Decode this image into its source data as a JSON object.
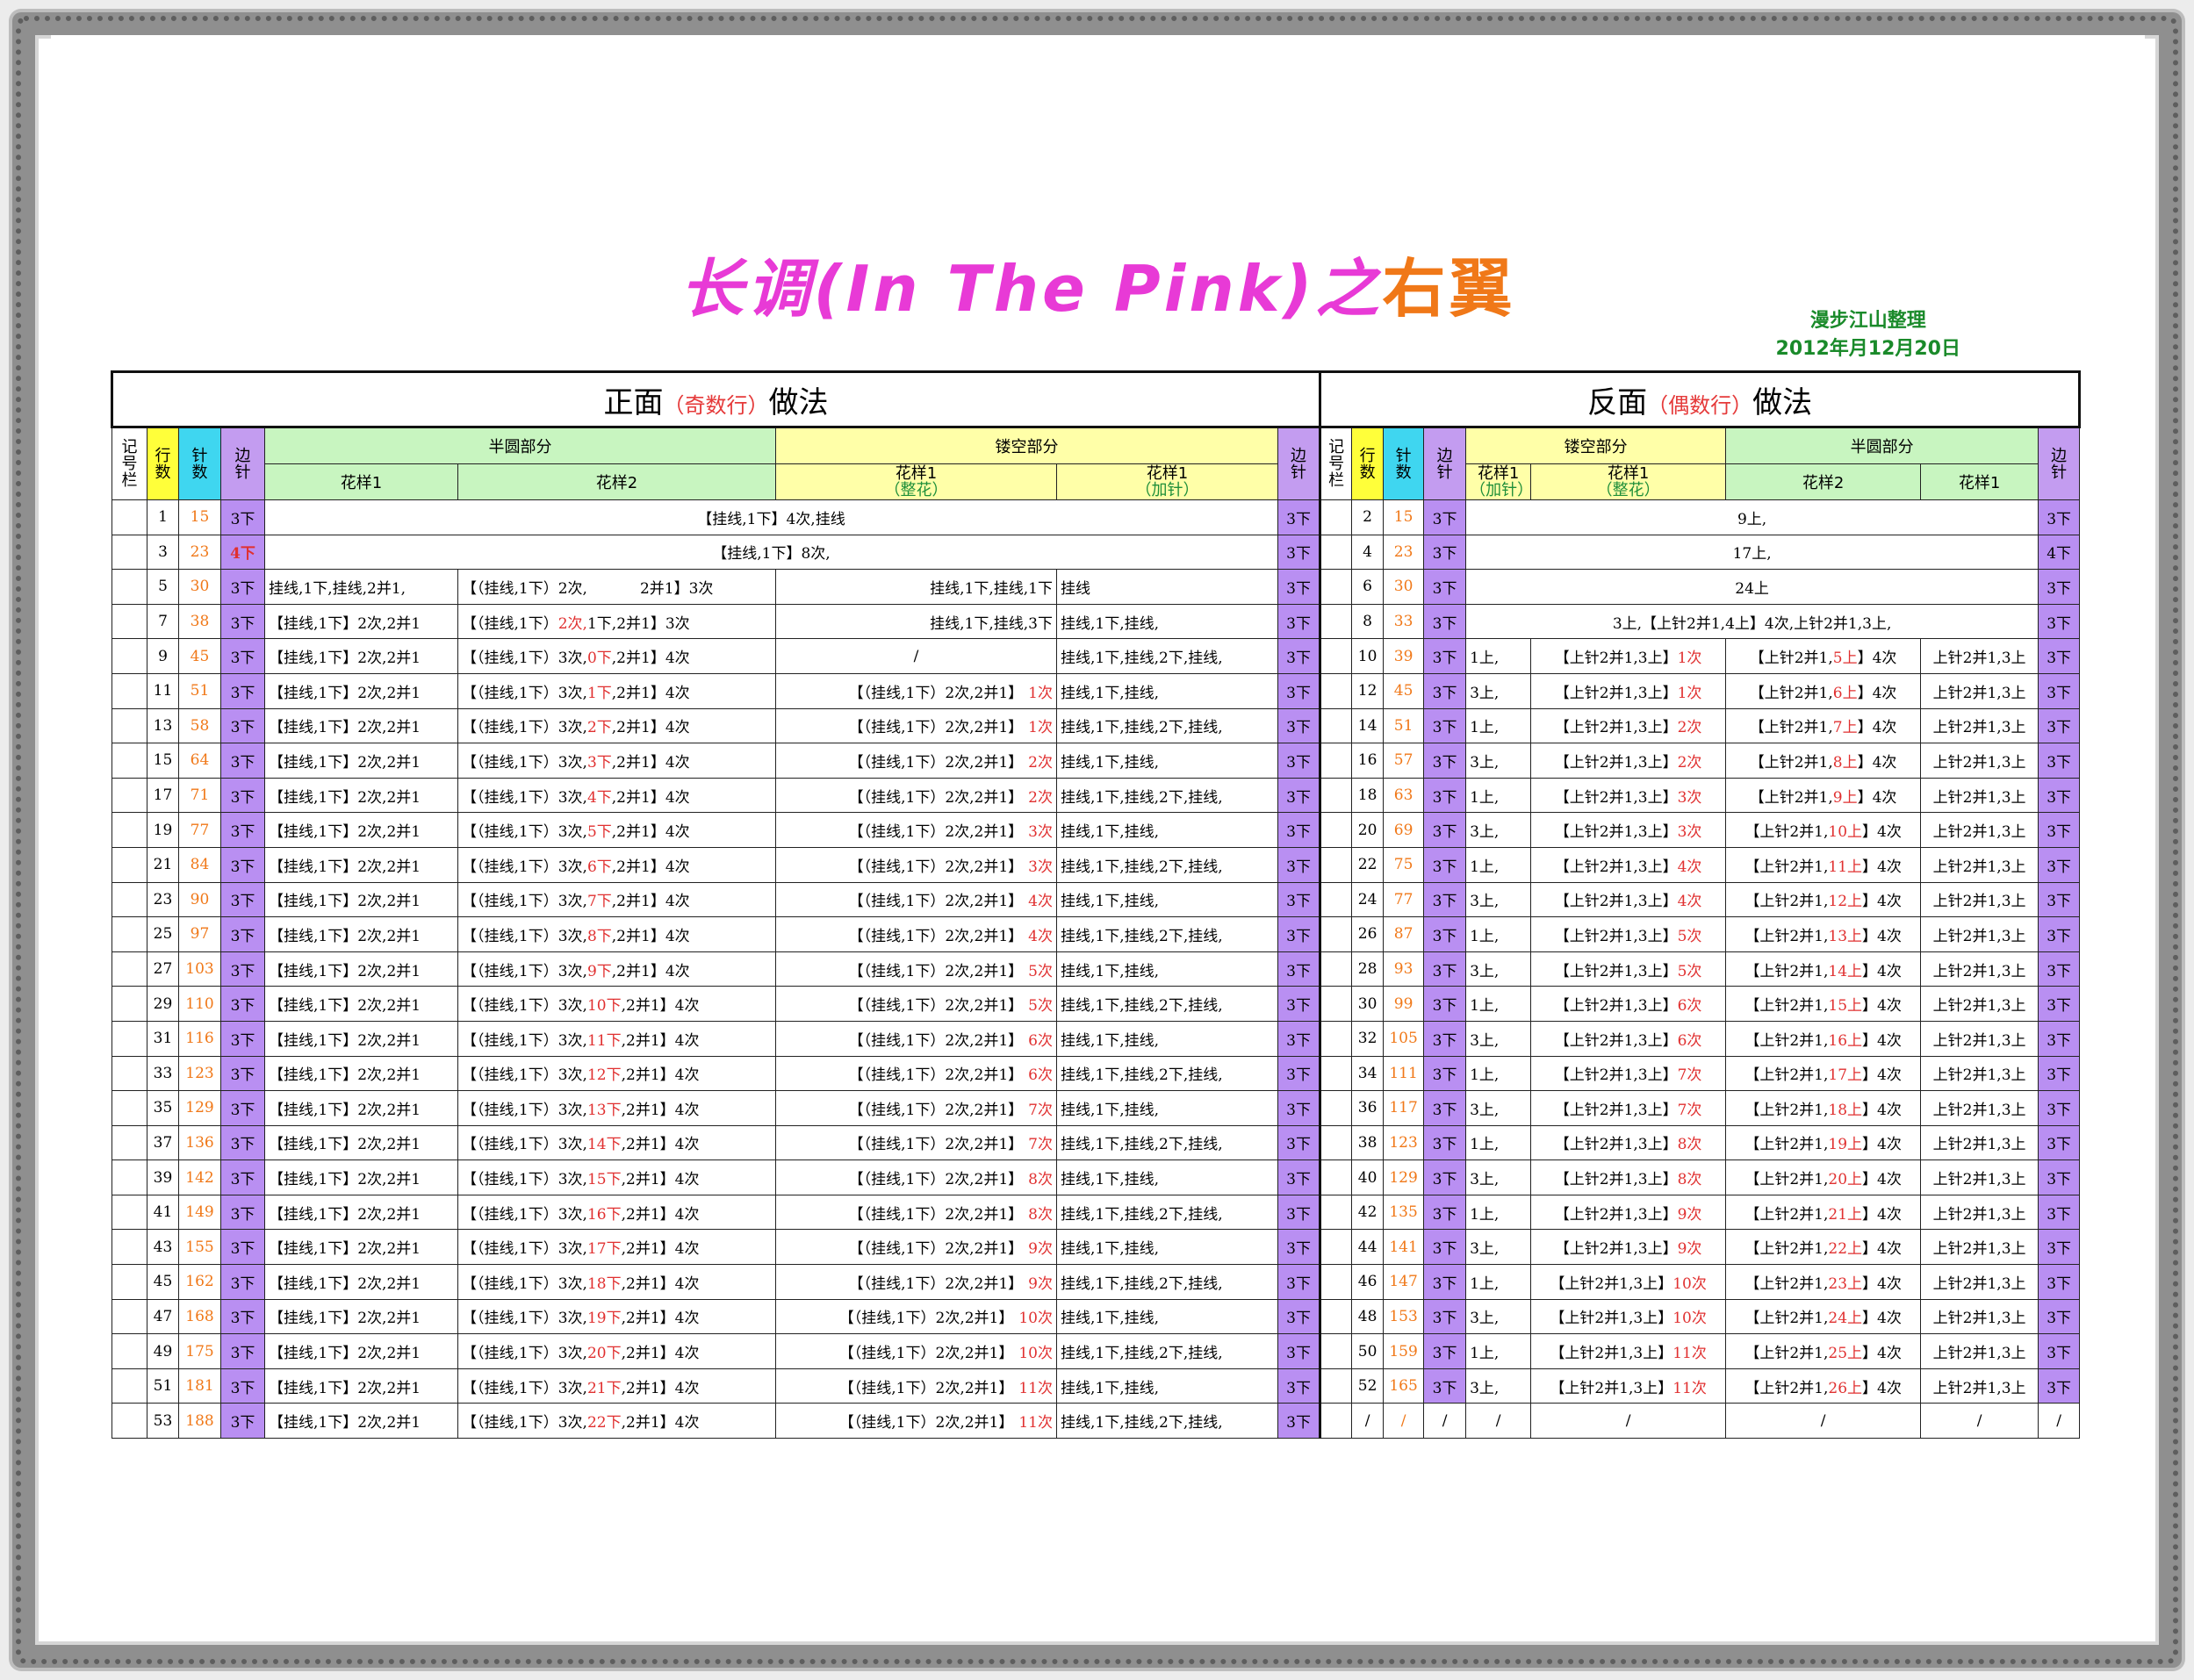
{
  "title": {
    "main": "长调(In The Pink)之",
    "accent": "右翼"
  },
  "credit": {
    "line1": "漫步江山整理",
    "line2": "2012年月12月20日"
  },
  "front": {
    "caption": "正面",
    "caption_sub": "（奇数行）",
    "caption_tail": "做法"
  },
  "back": {
    "caption": "反面",
    "caption_sub": "（偶数行）",
    "caption_tail": "做法"
  },
  "headers": {
    "jihao": "记号栏",
    "hang": "行数",
    "zhen": "针数",
    "bian": "边针",
    "banyuan": "半圆部分",
    "lougkong": "镂空部分",
    "huayang1": "花样1",
    "huayang2": "花样2",
    "zhenghua": "（整花）",
    "jiazhen": "（加针）"
  },
  "front_rows": [
    {
      "r": "1",
      "n": "15",
      "e": "3下",
      "merged": "【挂线,1下】4次,挂线"
    },
    {
      "r": "3",
      "n": "23",
      "e": "4下",
      "merged": "【挂线,1下】8次,"
    },
    {
      "r": "5",
      "n": "30",
      "e": "3下",
      "a": "挂线,1下,挂线,2并1,",
      "b1": "【（挂线,1下）2次,",
      "b2": "",
      "b3": "2并1】3次",
      "c1": "挂线,1下,挂线,1下",
      "c2": "",
      "d": "挂线"
    },
    {
      "r": "7",
      "n": "38",
      "e": "3下",
      "a": "【挂线,1下】2次,2并1",
      "b1": "【（挂线,1下）",
      "b2": "2次,",
      "b3": "1下,2并1】3次",
      "c1": "挂线,1下,挂线,3下",
      "c2": "",
      "d": "挂线,1下,挂线,"
    },
    {
      "r": "9",
      "n": "45",
      "e": "3下",
      "a": "【挂线,1下】2次,2并1",
      "b1": "【（挂线,1下）3次,",
      "b2": "0下",
      "b3": ",2并1】4次",
      "c1": "/",
      "c2": "",
      "d": "挂线,1下,挂线,2下,挂线,"
    },
    {
      "r": "11",
      "n": "51",
      "e": "3下",
      "a": "【挂线,1下】2次,2并1",
      "b1": "【（挂线,1下）3次,",
      "b2": "1下",
      "b3": ",2并1】4次",
      "c1": "【（挂线,1下）2次,2并1】",
      "c2": "1次",
      "d": "挂线,1下,挂线,"
    },
    {
      "r": "13",
      "n": "58",
      "e": "3下",
      "a": "【挂线,1下】2次,2并1",
      "b1": "【（挂线,1下）3次,",
      "b2": "2下",
      "b3": ",2并1】4次",
      "c1": "【（挂线,1下）2次,2并1】",
      "c2": "1次",
      "d": "挂线,1下,挂线,2下,挂线,"
    },
    {
      "r": "15",
      "n": "64",
      "e": "3下",
      "a": "【挂线,1下】2次,2并1",
      "b1": "【（挂线,1下）3次,",
      "b2": "3下",
      "b3": ",2并1】4次",
      "c1": "【（挂线,1下）2次,2并1】",
      "c2": "2次",
      "d": "挂线,1下,挂线,"
    },
    {
      "r": "17",
      "n": "71",
      "e": "3下",
      "a": "【挂线,1下】2次,2并1",
      "b1": "【（挂线,1下）3次,",
      "b2": "4下",
      "b3": ",2并1】4次",
      "c1": "【（挂线,1下）2次,2并1】",
      "c2": "2次",
      "d": "挂线,1下,挂线,2下,挂线,"
    },
    {
      "r": "19",
      "n": "77",
      "e": "3下",
      "a": "【挂线,1下】2次,2并1",
      "b1": "【（挂线,1下）3次,",
      "b2": "5下",
      "b3": ",2并1】4次",
      "c1": "【（挂线,1下）2次,2并1】",
      "c2": "3次",
      "d": "挂线,1下,挂线,"
    },
    {
      "r": "21",
      "n": "84",
      "e": "3下",
      "a": "【挂线,1下】2次,2并1",
      "b1": "【（挂线,1下）3次,",
      "b2": "6下",
      "b3": ",2并1】4次",
      "c1": "【（挂线,1下）2次,2并1】",
      "c2": "3次",
      "d": "挂线,1下,挂线,2下,挂线,"
    },
    {
      "r": "23",
      "n": "90",
      "e": "3下",
      "a": "【挂线,1下】2次,2并1",
      "b1": "【（挂线,1下）3次,",
      "b2": "7下",
      "b3": ",2并1】4次",
      "c1": "【（挂线,1下）2次,2并1】",
      "c2": "4次",
      "d": "挂线,1下,挂线,"
    },
    {
      "r": "25",
      "n": "97",
      "e": "3下",
      "a": "【挂线,1下】2次,2并1",
      "b1": "【（挂线,1下）3次,",
      "b2": "8下",
      "b3": ",2并1】4次",
      "c1": "【（挂线,1下）2次,2并1】",
      "c2": "4次",
      "d": "挂线,1下,挂线,2下,挂线,"
    },
    {
      "r": "27",
      "n": "103",
      "e": "3下",
      "a": "【挂线,1下】2次,2并1",
      "b1": "【（挂线,1下）3次,",
      "b2": "9下",
      "b3": ",2并1】4次",
      "c1": "【（挂线,1下）2次,2并1】",
      "c2": "5次",
      "d": "挂线,1下,挂线,"
    },
    {
      "r": "29",
      "n": "110",
      "e": "3下",
      "a": "【挂线,1下】2次,2并1",
      "b1": "【（挂线,1下）3次,",
      "b2": "10下",
      "b3": ",2并1】4次",
      "c1": "【（挂线,1下）2次,2并1】",
      "c2": "5次",
      "d": "挂线,1下,挂线,2下,挂线,"
    },
    {
      "r": "31",
      "n": "116",
      "e": "3下",
      "a": "【挂线,1下】2次,2并1",
      "b1": "【（挂线,1下）3次,",
      "b2": "11下",
      "b3": ",2并1】4次",
      "c1": "【（挂线,1下）2次,2并1】",
      "c2": "6次",
      "d": "挂线,1下,挂线,"
    },
    {
      "r": "33",
      "n": "123",
      "e": "3下",
      "a": "【挂线,1下】2次,2并1",
      "b1": "【（挂线,1下）3次,",
      "b2": "12下",
      "b3": ",2并1】4次",
      "c1": "【（挂线,1下）2次,2并1】",
      "c2": "6次",
      "d": "挂线,1下,挂线,2下,挂线,"
    },
    {
      "r": "35",
      "n": "129",
      "e": "3下",
      "a": "【挂线,1下】2次,2并1",
      "b1": "【（挂线,1下）3次,",
      "b2": "13下",
      "b3": ",2并1】4次",
      "c1": "【（挂线,1下）2次,2并1】",
      "c2": "7次",
      "d": "挂线,1下,挂线,"
    },
    {
      "r": "37",
      "n": "136",
      "e": "3下",
      "a": "【挂线,1下】2次,2并1",
      "b1": "【（挂线,1下）3次,",
      "b2": "14下",
      "b3": ",2并1】4次",
      "c1": "【（挂线,1下）2次,2并1】",
      "c2": "7次",
      "d": "挂线,1下,挂线,2下,挂线,"
    },
    {
      "r": "39",
      "n": "142",
      "e": "3下",
      "a": "【挂线,1下】2次,2并1",
      "b1": "【（挂线,1下）3次,",
      "b2": "15下",
      "b3": ",2并1】4次",
      "c1": "【（挂线,1下）2次,2并1】",
      "c2": "8次",
      "d": "挂线,1下,挂线,"
    },
    {
      "r": "41",
      "n": "149",
      "e": "3下",
      "a": "【挂线,1下】2次,2并1",
      "b1": "【（挂线,1下）3次,",
      "b2": "16下",
      "b3": ",2并1】4次",
      "c1": "【（挂线,1下）2次,2并1】",
      "c2": "8次",
      "d": "挂线,1下,挂线,2下,挂线,"
    },
    {
      "r": "43",
      "n": "155",
      "e": "3下",
      "a": "【挂线,1下】2次,2并1",
      "b1": "【（挂线,1下）3次,",
      "b2": "17下",
      "b3": ",2并1】4次",
      "c1": "【（挂线,1下）2次,2并1】",
      "c2": "9次",
      "d": "挂线,1下,挂线,"
    },
    {
      "r": "45",
      "n": "162",
      "e": "3下",
      "a": "【挂线,1下】2次,2并1",
      "b1": "【（挂线,1下）3次,",
      "b2": "18下",
      "b3": ",2并1】4次",
      "c1": "【（挂线,1下）2次,2并1】",
      "c2": "9次",
      "d": "挂线,1下,挂线,2下,挂线,"
    },
    {
      "r": "47",
      "n": "168",
      "e": "3下",
      "a": "【挂线,1下】2次,2并1",
      "b1": "【（挂线,1下）3次,",
      "b2": "19下",
      "b3": ",2并1】4次",
      "c1": "【（挂线,1下）2次,2并1】",
      "c2": "10次",
      "d": "挂线,1下,挂线,"
    },
    {
      "r": "49",
      "n": "175",
      "e": "3下",
      "a": "【挂线,1下】2次,2并1",
      "b1": "【（挂线,1下）3次,",
      "b2": "20下",
      "b3": ",2并1】4次",
      "c1": "【（挂线,1下）2次,2并1】",
      "c2": "10次",
      "d": "挂线,1下,挂线,2下,挂线,"
    },
    {
      "r": "51",
      "n": "181",
      "e": "3下",
      "a": "【挂线,1下】2次,2并1",
      "b1": "【（挂线,1下）3次,",
      "b2": "21下",
      "b3": ",2并1】4次",
      "c1": "【（挂线,1下）2次,2并1】",
      "c2": "11次",
      "d": "挂线,1下,挂线,"
    },
    {
      "r": "53",
      "n": "188",
      "e": "3下",
      "a": "【挂线,1下】2次,2并1",
      "b1": "【（挂线,1下）3次,",
      "b2": "22下",
      "b3": ",2并1】4次",
      "c1": "【（挂线,1下）2次,2并1】",
      "c2": "11次",
      "d": "挂线,1下,挂线,2下,挂线,"
    }
  ],
  "front_edge_right": "3下",
  "back_rows": [
    {
      "r": "2",
      "n": "15",
      "e": "3下",
      "merged": "9上,",
      "er": "3下"
    },
    {
      "r": "4",
      "n": "23",
      "e": "3下",
      "merged": "17上,",
      "er": "4下"
    },
    {
      "r": "6",
      "n": "30",
      "e": "3下",
      "merged": "24上",
      "er": "3下"
    },
    {
      "r": "8",
      "n": "33",
      "e": "3下",
      "merged": "3上,【上针2并1,4上】4次,上针2并1,3上,",
      "er": "3下"
    },
    {
      "r": "10",
      "n": "39",
      "e": "3下",
      "a": "1上,",
      "b1": "【上针2并1,3上】",
      "b2": "1次",
      "c1": "【上针2并1,",
      "c2": "5上",
      "c3": "】4次",
      "d": "上针2并1,3上",
      "er": "3下"
    },
    {
      "r": "12",
      "n": "45",
      "e": "3下",
      "a": "3上,",
      "b1": "【上针2并1,3上】",
      "b2": "1次",
      "c1": "【上针2并1,",
      "c2": "6上",
      "c3": "】4次",
      "d": "上针2并1,3上",
      "er": "3下"
    },
    {
      "r": "14",
      "n": "51",
      "e": "3下",
      "a": "1上,",
      "b1": "【上针2并1,3上】",
      "b2": "2次",
      "c1": "【上针2并1,",
      "c2": "7上",
      "c3": "】4次",
      "d": "上针2并1,3上",
      "er": "3下"
    },
    {
      "r": "16",
      "n": "57",
      "e": "3下",
      "a": "3上,",
      "b1": "【上针2并1,3上】",
      "b2": "2次",
      "c1": "【上针2并1,",
      "c2": "8上",
      "c3": "】4次",
      "d": "上针2并1,3上",
      "er": "3下"
    },
    {
      "r": "18",
      "n": "63",
      "e": "3下",
      "a": "1上,",
      "b1": "【上针2并1,3上】",
      "b2": "3次",
      "c1": "【上针2并1,",
      "c2": "9上",
      "c3": "】4次",
      "d": "上针2并1,3上",
      "er": "3下"
    },
    {
      "r": "20",
      "n": "69",
      "e": "3下",
      "a": "3上,",
      "b1": "【上针2并1,3上】",
      "b2": "3次",
      "c1": "【上针2并1,",
      "c2": "10上",
      "c3": "】4次",
      "d": "上针2并1,3上",
      "er": "3下"
    },
    {
      "r": "22",
      "n": "75",
      "e": "3下",
      "a": "1上,",
      "b1": "【上针2并1,3上】",
      "b2": "4次",
      "c1": "【上针2并1,",
      "c2": "11上",
      "c3": "】4次",
      "d": "上针2并1,3上",
      "er": "3下"
    },
    {
      "r": "24",
      "n": "77",
      "e": "3下",
      "a": "3上,",
      "b1": "【上针2并1,3上】",
      "b2": "4次",
      "c1": "【上针2并1,",
      "c2": "12上",
      "c3": "】4次",
      "d": "上针2并1,3上",
      "er": "3下"
    },
    {
      "r": "26",
      "n": "87",
      "e": "3下",
      "a": "1上,",
      "b1": "【上针2并1,3上】",
      "b2": "5次",
      "c1": "【上针2并1,",
      "c2": "13上",
      "c3": "】4次",
      "d": "上针2并1,3上",
      "er": "3下"
    },
    {
      "r": "28",
      "n": "93",
      "e": "3下",
      "a": "3上,",
      "b1": "【上针2并1,3上】",
      "b2": "5次",
      "c1": "【上针2并1,",
      "c2": "14上",
      "c3": "】4次",
      "d": "上针2并1,3上",
      "er": "3下"
    },
    {
      "r": "30",
      "n": "99",
      "e": "3下",
      "a": "1上,",
      "b1": "【上针2并1,3上】",
      "b2": "6次",
      "c1": "【上针2并1,",
      "c2": "15上",
      "c3": "】4次",
      "d": "上针2并1,3上",
      "er": "3下"
    },
    {
      "r": "32",
      "n": "105",
      "e": "3下",
      "a": "3上,",
      "b1": "【上针2并1,3上】",
      "b2": "6次",
      "c1": "【上针2并1,",
      "c2": "16上",
      "c3": "】4次",
      "d": "上针2并1,3上",
      "er": "3下"
    },
    {
      "r": "34",
      "n": "111",
      "e": "3下",
      "a": "1上,",
      "b1": "【上针2并1,3上】",
      "b2": "7次",
      "c1": "【上针2并1,",
      "c2": "17上",
      "c3": "】4次",
      "d": "上针2并1,3上",
      "er": "3下"
    },
    {
      "r": "36",
      "n": "117",
      "e": "3下",
      "a": "3上,",
      "b1": "【上针2并1,3上】",
      "b2": "7次",
      "c1": "【上针2并1,",
      "c2": "18上",
      "c3": "】4次",
      "d": "上针2并1,3上",
      "er": "3下"
    },
    {
      "r": "38",
      "n": "123",
      "e": "3下",
      "a": "1上,",
      "b1": "【上针2并1,3上】",
      "b2": "8次",
      "c1": "【上针2并1,",
      "c2": "19上",
      "c3": "】4次",
      "d": "上针2并1,3上",
      "er": "3下"
    },
    {
      "r": "40",
      "n": "129",
      "e": "3下",
      "a": "3上,",
      "b1": "【上针2并1,3上】",
      "b2": "8次",
      "c1": "【上针2并1,",
      "c2": "20上",
      "c3": "】4次",
      "d": "上针2并1,3上",
      "er": "3下"
    },
    {
      "r": "42",
      "n": "135",
      "e": "3下",
      "a": "1上,",
      "b1": "【上针2并1,3上】",
      "b2": "9次",
      "c1": "【上针2并1,",
      "c2": "21上",
      "c3": "】4次",
      "d": "上针2并1,3上",
      "er": "3下"
    },
    {
      "r": "44",
      "n": "141",
      "e": "3下",
      "a": "3上,",
      "b1": "【上针2并1,3上】",
      "b2": "9次",
      "c1": "【上针2并1,",
      "c2": "22上",
      "c3": "】4次",
      "d": "上针2并1,3上",
      "er": "3下"
    },
    {
      "r": "46",
      "n": "147",
      "e": "3下",
      "a": "1上,",
      "b1": "【上针2并1,3上】",
      "b2": "10次",
      "c1": "【上针2并1,",
      "c2": "23上",
      "c3": "】4次",
      "d": "上针2并1,3上",
      "er": "3下"
    },
    {
      "r": "48",
      "n": "153",
      "e": "3下",
      "a": "3上,",
      "b1": "【上针2并1,3上】",
      "b2": "10次",
      "c1": "【上针2并1,",
      "c2": "24上",
      "c3": "】4次",
      "d": "上针2并1,3上",
      "er": "3下"
    },
    {
      "r": "50",
      "n": "159",
      "e": "3下",
      "a": "1上,",
      "b1": "【上针2并1,3上】",
      "b2": "11次",
      "c1": "【上针2并1,",
      "c2": "25上",
      "c3": "】4次",
      "d": "上针2并1,3上",
      "er": "3下"
    },
    {
      "r": "52",
      "n": "165",
      "e": "3下",
      "a": "3上,",
      "b1": "【上针2并1,3上】",
      "b2": "11次",
      "c1": "【上针2并1,",
      "c2": "26上",
      "c3": "】4次",
      "d": "上针2并1,3上",
      "er": "3下"
    },
    {
      "r": "/",
      "n": "/",
      "e": "/",
      "a": "/",
      "b1": "/",
      "b2": "",
      "c1": "/",
      "c2": "",
      "c3": "",
      "d": "/",
      "er": "/"
    }
  ]
}
